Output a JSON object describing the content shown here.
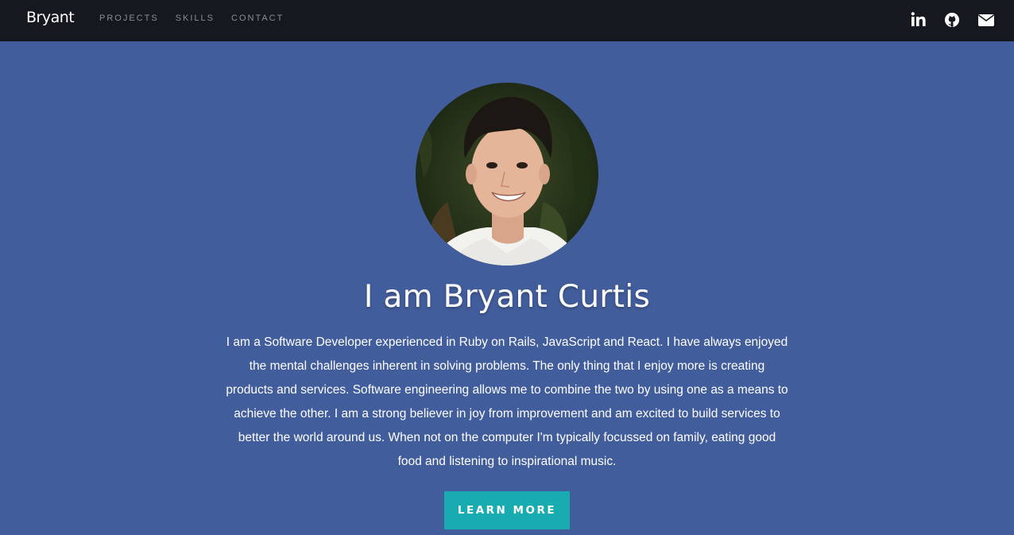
{
  "nav": {
    "brand": "Bryant",
    "links": [
      "PROJECTS",
      "SKILLS",
      "CONTACT"
    ],
    "social": [
      "linkedin-icon",
      "github-icon",
      "envelope-icon"
    ]
  },
  "hero": {
    "title": "I am Bryant Curtis",
    "bio": "I am a Software Developer experienced in Ruby on Rails, JavaScript and React. I have always enjoyed the mental challenges inherent in solving problems. The only thing that I enjoy more is creating products and services. Software engineering allows me to combine the two by using one as a means to achieve the other. I am a strong believer in joy from improvement and am excited to build services to better the world around us. When not on the computer I'm typically focussed on family, eating good food and listening to inspirational music.",
    "cta_label": "LEARN MORE"
  },
  "colors": {
    "nav_bg": "#15181e",
    "hero_bg": "#425d9b",
    "cta_bg": "#18acb0"
  }
}
